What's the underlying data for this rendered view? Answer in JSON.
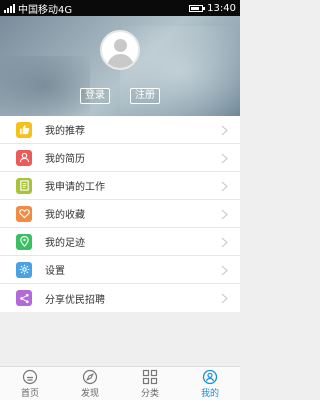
{
  "status_bar": {
    "carrier": "中国移动4G",
    "time": "13:40"
  },
  "profile": {
    "login_label": "登录",
    "register_label": "注册"
  },
  "menu": {
    "items": [
      {
        "label": "我的推荐",
        "icon": "thumbs-up-icon",
        "color": "#f5c21b"
      },
      {
        "label": "我的简历",
        "icon": "user-icon",
        "color": "#ec5b5b"
      },
      {
        "label": "我申请的工作",
        "icon": "document-icon",
        "color": "#a8c33b"
      },
      {
        "label": "我的收藏",
        "icon": "heart-icon",
        "color": "#f08c45"
      },
      {
        "label": "我的足迹",
        "icon": "location-icon",
        "color": "#3cbf62"
      },
      {
        "label": "设置",
        "icon": "gear-icon",
        "color": "#4aa3e0"
      },
      {
        "label": "分享优民招聘",
        "icon": "share-icon",
        "color": "#b26bd6"
      }
    ]
  },
  "tabbar": {
    "active_color": "#1a8fd6",
    "tabs": [
      {
        "label": "首页",
        "icon": "home-icon"
      },
      {
        "label": "发现",
        "icon": "compass-icon"
      },
      {
        "label": "分类",
        "icon": "grid-icon"
      },
      {
        "label": "我的",
        "icon": "profile-icon"
      }
    ]
  }
}
